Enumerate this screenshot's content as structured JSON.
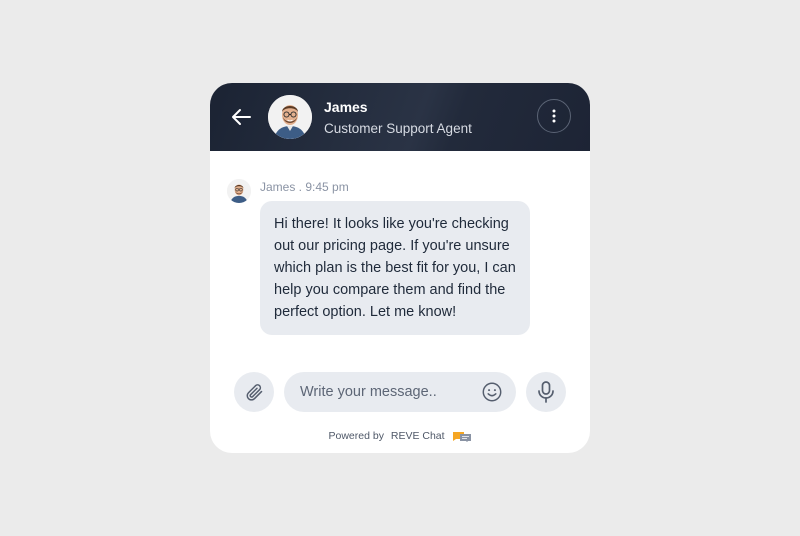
{
  "header": {
    "agent_name": "James",
    "agent_role": "Customer Support Agent",
    "back_icon": "arrow-left-icon",
    "menu_icon": "more-vertical-icon"
  },
  "message": {
    "sender": "James",
    "time": "9:45 pm",
    "text": "Hi there! It looks like you're checking out our pricing page. If you're unsure which plan is the best fit for you, I can help you compare them and find the perfect option. Let me know!"
  },
  "composer": {
    "placeholder": "Write your message..",
    "value": "",
    "attach_icon": "paperclip-icon",
    "emoji_icon": "smiley-icon",
    "mic_icon": "microphone-icon"
  },
  "footer": {
    "powered_by": "Powered by",
    "brand": "REVE Chat"
  },
  "colors": {
    "header_bg": "#1f2636",
    "bubble_bg": "#e8ebf0",
    "page_bg": "#ebebeb",
    "brand_orange": "#f5a623"
  }
}
